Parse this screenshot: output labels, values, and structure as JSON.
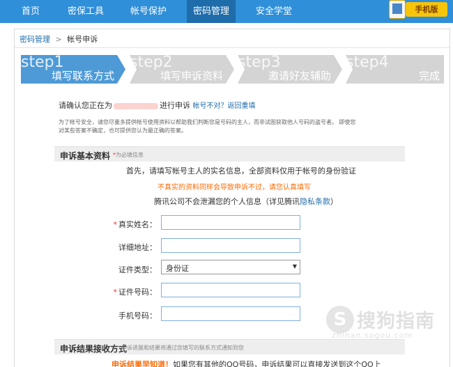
{
  "nav": {
    "items": [
      {
        "label": "首页"
      },
      {
        "label": "密保工具"
      },
      {
        "label": "帐号保护"
      },
      {
        "label": "密码管理"
      },
      {
        "label": "安全学堂"
      }
    ],
    "active": "密码管理",
    "mobile_label": "手机版"
  },
  "breadcrumb": {
    "parent": "密码管理",
    "separator": ">",
    "current": "帐号申诉"
  },
  "steps": [
    {
      "en": "step1",
      "cn": "填写联系方式",
      "state": "active"
    },
    {
      "en": "step2",
      "cn": "填写申诉资料",
      "state": "inactive"
    },
    {
      "en": "step3",
      "cn": "邀请好友辅助",
      "state": "inactive"
    },
    {
      "en": "step4",
      "cn": "完成",
      "state": "inactive"
    }
  ],
  "confirm": {
    "prefix": "请确认您正在为",
    "suffix": "进行申诉",
    "link": "帐号不对？返回重填"
  },
  "note": "为了帐号安全，请您尽量多提供帐号使用资料以帮助我们判断您是号码的主人，而非试图获取他人号码的盗号者。 即使您对某些答案不确定，也可提供您认为最正确的答案。",
  "section1": {
    "title": "申诉基本资料",
    "sub": "为必填信息",
    "sub_star": "*"
  },
  "intro": {
    "line1": "首先，请填写帐号主人的实名信息，全部资料仅用于帐号的身份验证",
    "line2": "不真实的资料同样会导致申诉不过，请您认真填写",
    "line3_prefix": "腾讯公司不会泄漏您的个人信息（详见腾讯",
    "line3_link": "隐私条款",
    "line3_suffix": "）"
  },
  "form": {
    "real_name": {
      "label": "真实姓名：",
      "required": "*",
      "value": ""
    },
    "address": {
      "label": "详细地址：",
      "value": ""
    },
    "id_type": {
      "label": "证件类型：",
      "value": "身份证"
    },
    "id_number": {
      "label": "证件号码：",
      "required": "*",
      "value": ""
    },
    "phone": {
      "label": "手机号码：",
      "value": ""
    }
  },
  "section2": {
    "title": "申诉结果接收方式",
    "sub": "申诉进展和结果将通过您填写的联系方式通知到您"
  },
  "bottom": {
    "highlight": "申诉结果早知道！",
    "text": "如果您有其他的QQ号码，申诉结果可以直接发送到这个QQ上"
  },
  "watermark": {
    "cn": "搜狗指南",
    "en": "zhinan.sogou.com",
    "glyph": "S"
  },
  "colors": {
    "nav_bg": "#2f8fd8",
    "nav_active": "#1f6cab",
    "step_active": "#4e9ad6",
    "step_inactive": "#d4d4d4",
    "accent_orange": "#ff6a00"
  }
}
